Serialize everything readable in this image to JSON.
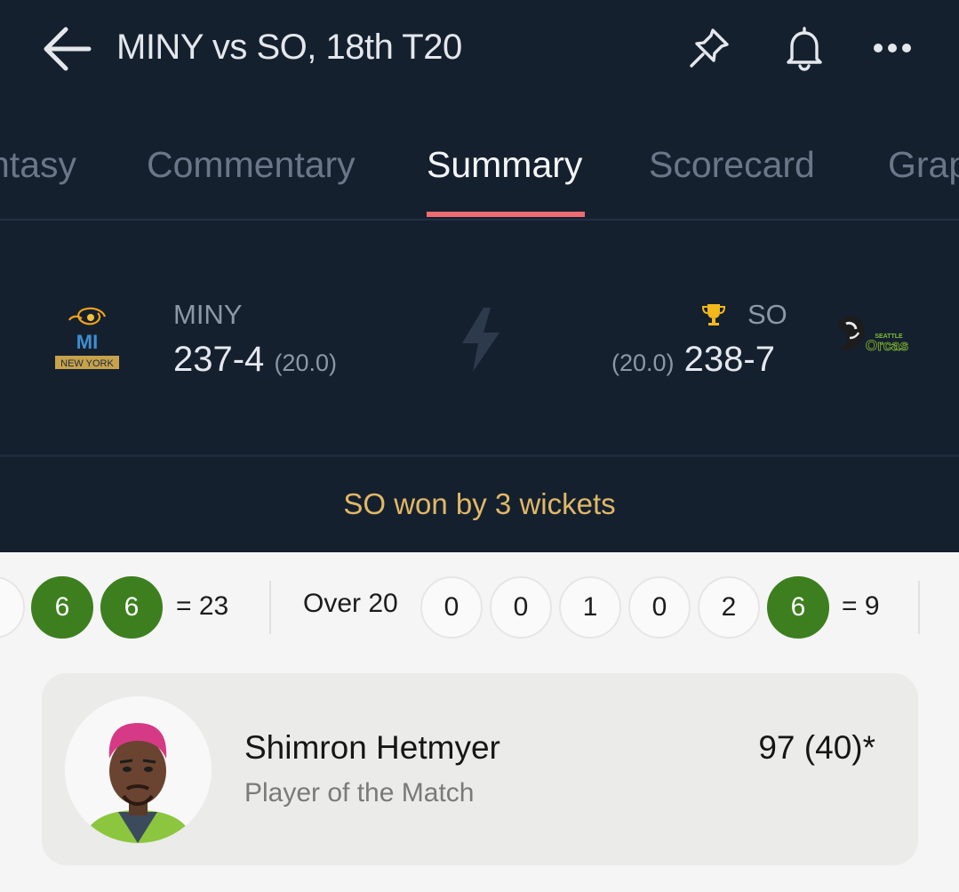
{
  "header": {
    "title": "MINY vs SO, 18th T20",
    "icons": [
      "back-arrow-icon",
      "pin-icon",
      "bell-icon",
      "more-icon"
    ]
  },
  "tabs": [
    {
      "label": "ntasy",
      "active": false
    },
    {
      "label": "Commentary",
      "active": false
    },
    {
      "label": "Summary",
      "active": true
    },
    {
      "label": "Scorecard",
      "active": false
    },
    {
      "label": "Grap",
      "active": false
    }
  ],
  "match": {
    "team1": {
      "name": "MINY",
      "score": "237-4",
      "overs": "(20.0)",
      "logo_text": "MI",
      "logo_subtext": "NEW YORK"
    },
    "team2": {
      "name": "SO",
      "score": "238-7",
      "overs": "(20.0)",
      "logo_text": "Orcas",
      "logo_subtext": "SEATTLE",
      "winner": true
    },
    "result": "SO won by 3 wickets"
  },
  "overs_strip": {
    "prev_over": {
      "balls": [
        "6",
        "6"
      ],
      "total": "= 23"
    },
    "current_over": {
      "label": "Over 20",
      "balls": [
        "0",
        "0",
        "1",
        "0",
        "2",
        "6"
      ],
      "total": "= 9"
    }
  },
  "player_of_match": {
    "name": "Shimron Hetmyer",
    "role": "Player of the Match",
    "score": "97 (40)*"
  },
  "colors": {
    "dark_bg": "#15202f",
    "accent_underline": "#ee6b72",
    "result_text": "#e0b866",
    "six_ball": "#3d7f1f",
    "trophy": "#f2b81c"
  }
}
